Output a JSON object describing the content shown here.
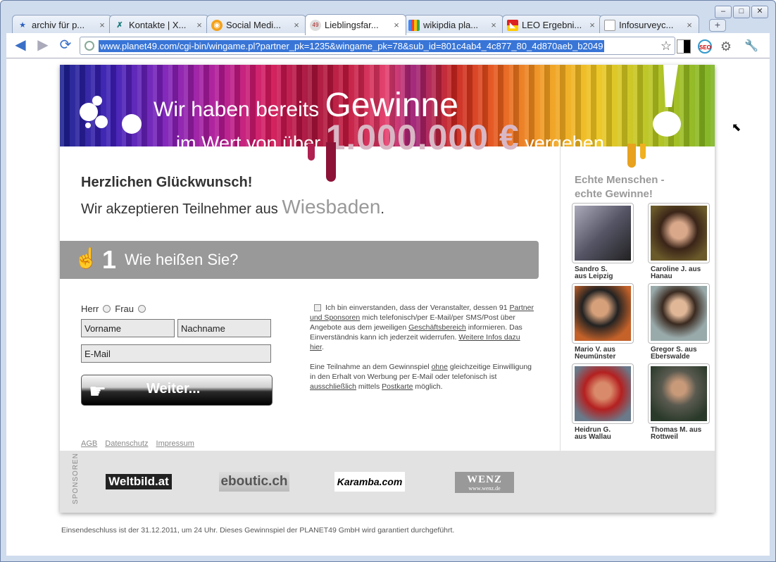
{
  "tabs": [
    {
      "label": "archiv für p...",
      "icon": "star-icon"
    },
    {
      "label": "Kontakte | X...",
      "icon": "xing-icon"
    },
    {
      "label": "Social Medi...",
      "icon": "social-icon"
    },
    {
      "label": "Lieblingsfar...",
      "icon": "planet49-icon"
    },
    {
      "label": "wikipdia pla...",
      "icon": "google-icon"
    },
    {
      "label": "LEO Ergebni...",
      "icon": "leo-icon"
    },
    {
      "label": "Infosurveyc...",
      "icon": "page-icon"
    }
  ],
  "url": "www.planet49.com/cgi-bin/wingame.pl?partner_pk=1235&wingame_pk=78&sub_id=801c4ab4_4c877_80_4d870aeb_b2049",
  "banner": {
    "line1_a": "Wir haben bereits",
    "line1_b": "Gewinne",
    "line2_a": "im Wert von über",
    "line2_amount": "1.000.000 €",
    "line2_b": "vergeben"
  },
  "greeting": "Herzlichen Glückwunsch!",
  "accept_text": "Wir akzeptieren Teilnehmer aus",
  "city": "Wiesbaden",
  "city_dot": ".",
  "step": {
    "number": "1",
    "question": "Wie heißen Sie?"
  },
  "form": {
    "herr": "Herr",
    "frau": "Frau",
    "vorname": "Vorname",
    "nachname": "Nachname",
    "email": "E-Mail",
    "submit": "Weiter..."
  },
  "consent": {
    "p1_a": "Ich bin einverstanden, dass der Veranstalter, dessen 91",
    "p1_link1": "Partner und Sponsoren",
    "p1_b": "mich telefonisch/per E-Mail/per SMS/Post über Angebote aus dem jeweiligen",
    "p1_link2": "Geschäftsbereich",
    "p1_c": "informieren. Das Einverständnis kann ich jederzeit widerrufen.",
    "p1_link3": "Weitere Infos dazu hier",
    "p1_d": ".",
    "p2_a": "Eine Teilnahme an dem Gewinnspiel",
    "p2_link1": "ohne",
    "p2_b": "gleichzeitige Einwilligung in den Erhalt von Werbung per E-Mail oder telefonisch ist",
    "p2_link2": "ausschließlich",
    "p2_c": "mittels",
    "p2_link3": "Postkarte",
    "p2_d": "möglich."
  },
  "footer_links": [
    "AGB",
    "Datenschutz",
    "Impressum"
  ],
  "winners_heading_1": "Echte Menschen -",
  "winners_heading_2": "echte Gewinne!",
  "winners": [
    {
      "name1": "Sandro S.",
      "name2": "aus Leipzig"
    },
    {
      "name1": "Caroline J. aus",
      "name2": "Hanau"
    },
    {
      "name1": "Mario V. aus",
      "name2": "Neumünster"
    },
    {
      "name1": "Gregor S. aus",
      "name2": "Eberswalde"
    },
    {
      "name1": "Heidrun G.",
      "name2": "aus Wallau"
    },
    {
      "name1": "Thomas M. aus",
      "name2": "Rottweil"
    }
  ],
  "sponsors_label": "SPONSOREN",
  "sponsors": [
    "Weltbild.at",
    "eboutic.ch",
    "Karamba.com",
    "WENZ"
  ],
  "sponsor_sub": "www.wenz.de",
  "disclaimer": "Einsendeschluss ist der 31.12.2011, um 24 Uhr. Dieses Gewinnspiel der PLANET49 GmbH wird garantiert durchgeführt."
}
